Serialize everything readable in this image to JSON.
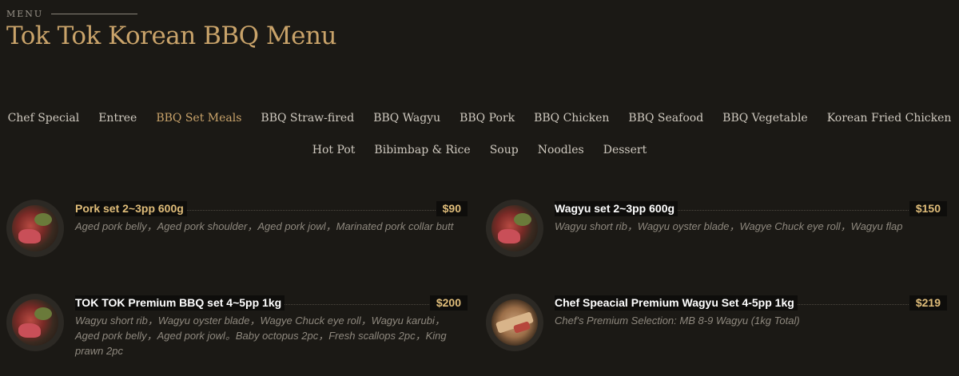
{
  "section": {
    "label": "MENU"
  },
  "page": {
    "title": "Tok Tok Korean BBQ Menu"
  },
  "tabs": {
    "row1": [
      "Chef Special",
      "Entree",
      "BBQ Set Meals",
      "BBQ Straw-fired",
      "BBQ Wagyu",
      "BBQ Pork",
      "BBQ Chicken",
      "BBQ Seafood",
      "BBQ Vegetable",
      "Korean Fried Chicken"
    ],
    "row2": [
      "Hot Pot",
      "Bibimbap & Rice",
      "Soup",
      "Noodles",
      "Dessert"
    ],
    "active": "BBQ Set Meals"
  },
  "items": [
    {
      "name": "Pork set 2~3pp 600g",
      "price": "$90",
      "desc": "Aged pork belly，Aged pork shoulder，Aged pork jowl，Marinated pork collar butt",
      "image": "bbq-meat-plate-icon"
    },
    {
      "name": "Wagyu set 2~3pp 600g",
      "price": "$150",
      "desc": "Wagyu short rib，Wagyu oyster blade，Wagye Chuck eye roll，Wagyu flap",
      "image": "bbq-meat-plate-icon"
    },
    {
      "name": "TOK TOK Premium BBQ set 4~5pp 1kg",
      "price": "$200",
      "desc": "Wagyu short rib，Wagyu oyster blade，Wagye Chuck eye roll，Wagyu karubi，Aged pork belly，Aged pork jowl。Baby octopus 2pc，Fresh scallops 2pc，King prawn 2pc",
      "image": "bbq-meat-plate-icon"
    },
    {
      "name": "Chef Speacial Premium Wagyu Set 4-5pp 1kg",
      "price": "$219",
      "desc": "Chef's Premium Selection: MB 8-9 Wagyu (1kg Total)",
      "image": "wagyu-board-icon"
    }
  ],
  "colors": {
    "accent": "#c9a36a",
    "background": "#1b1915",
    "price": "#e0bd7a"
  }
}
